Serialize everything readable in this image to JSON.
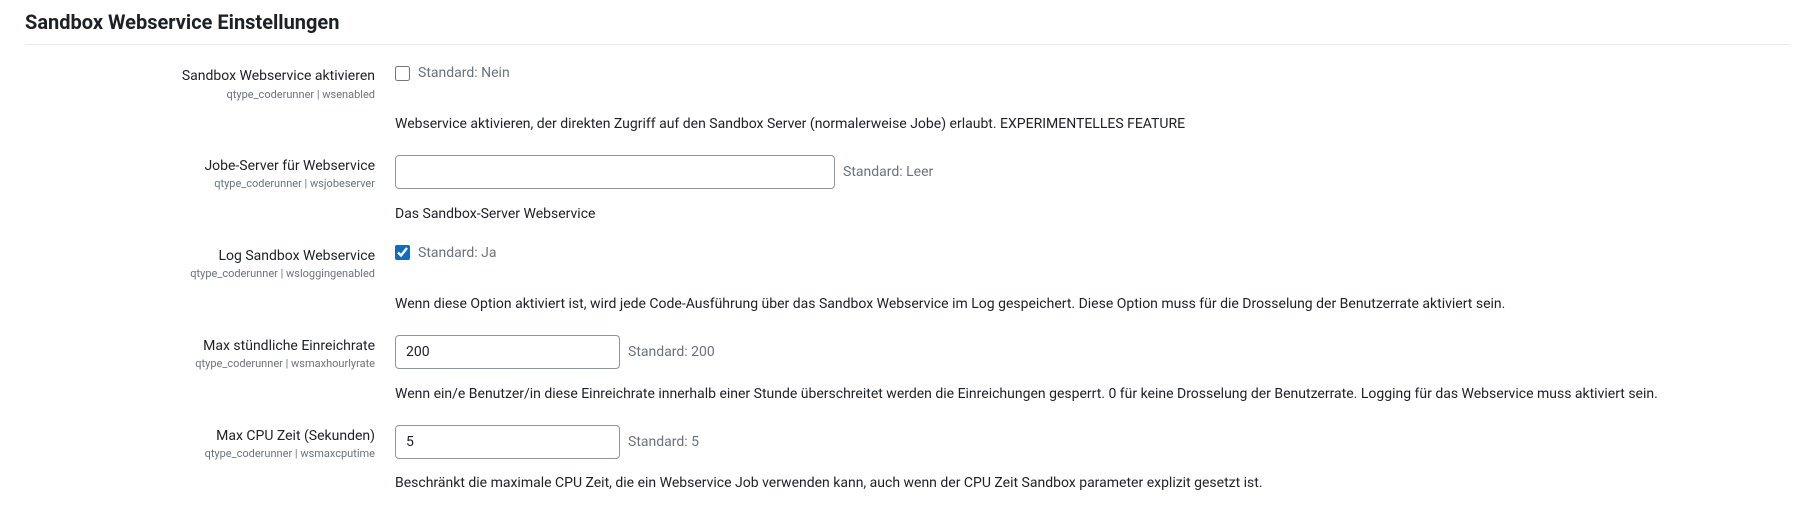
{
  "heading": "Sandbox Webservice Einstellungen",
  "settings": {
    "wsenabled": {
      "label": "Sandbox Webservice aktivieren",
      "key": "qtype_coderunner | wsenabled",
      "default": "Standard: Nein",
      "checked": false,
      "desc": "Webservice aktivieren, der direkten Zugriff auf den Sandbox Server (normalerweise Jobe) erlaubt. EXPERIMENTELLES FEATURE"
    },
    "wsjobeserver": {
      "label": "Jobe-Server für Webservice",
      "key": "qtype_coderunner | wsjobeserver",
      "default": "Standard: Leer",
      "value": "",
      "desc": "Das Sandbox-Server Webservice"
    },
    "wsloggingenabled": {
      "label": "Log Sandbox Webservice",
      "key": "qtype_coderunner | wsloggingenabled",
      "default": "Standard: Ja",
      "checked": true,
      "desc": "Wenn diese Option aktiviert ist, wird jede Code-Ausführung über das Sandbox Webservice im Log gespeichert. Diese Option muss für die Drosselung der Benutzerrate aktiviert sein."
    },
    "wsmaxhourlyrate": {
      "label": "Max stündliche Einreichrate",
      "key": "qtype_coderunner | wsmaxhourlyrate",
      "default": "Standard: 200",
      "value": "200",
      "desc": "Wenn ein/e Benutzer/in diese Einreichrate innerhalb einer Stunde überschreitet werden die Einreichungen gesperrt. 0 für keine Drosselung der Benutzerrate. Logging für das Webservice muss aktiviert sein."
    },
    "wsmaxcputime": {
      "label": "Max CPU Zeit (Sekunden)",
      "key": "qtype_coderunner | wsmaxcputime",
      "default": "Standard: 5",
      "value": "5",
      "desc": "Beschränkt die maximale CPU Zeit, die ein Webservice Job verwenden kann, auch wenn der CPU Zeit Sandbox parameter explizit gesetzt ist."
    }
  }
}
